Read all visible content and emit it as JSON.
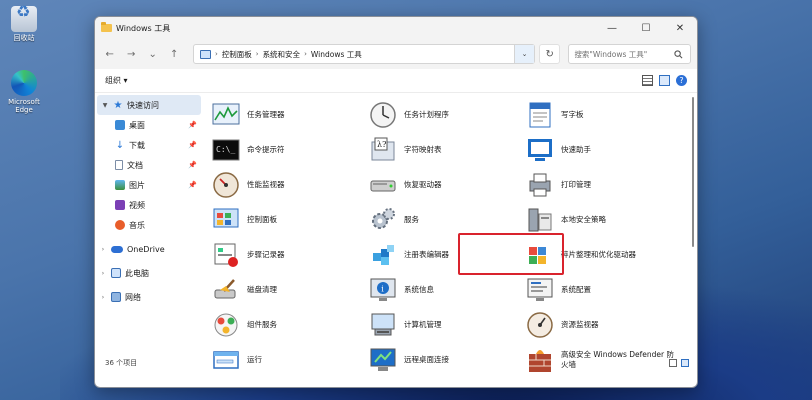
{
  "desktop": {
    "icons": [
      {
        "label": "回收站",
        "icon": "recycle-bin-icon"
      },
      {
        "label": "Microsoft Edge",
        "icon": "edge-icon"
      }
    ]
  },
  "window": {
    "title": "Windows 工具",
    "controls": {
      "minimize": "—",
      "maximize": "☐",
      "close": "✕"
    }
  },
  "nav": {
    "back": "←",
    "forward": "→",
    "dropdown": "⌄",
    "up": "↑",
    "breadcrumb": [
      "控制面板",
      "系统和安全",
      "Windows 工具"
    ],
    "separator": "›",
    "refresh": "↻",
    "search_placeholder": "搜索\"Windows 工具\""
  },
  "toolbar": {
    "organize": "组织 ▾"
  },
  "sidebar": {
    "quick_access": "快速访问",
    "pinned": [
      {
        "label": "桌面",
        "icon": "desktop-icon"
      },
      {
        "label": "下载",
        "icon": "download-icon"
      },
      {
        "label": "文档",
        "icon": "document-icon"
      },
      {
        "label": "图片",
        "icon": "pictures-icon"
      }
    ],
    "unpinned": [
      {
        "label": "视频",
        "icon": "video-icon"
      },
      {
        "label": "音乐",
        "icon": "music-icon"
      }
    ],
    "roots": [
      {
        "label": "OneDrive",
        "icon": "onedrive-icon"
      },
      {
        "label": "此电脑",
        "icon": "this-pc-icon"
      },
      {
        "label": "网络",
        "icon": "network-icon"
      }
    ]
  },
  "items": [
    {
      "label": "任务管理器",
      "icon": "task-manager-icon"
    },
    {
      "label": "任务计划程序",
      "icon": "task-scheduler-icon"
    },
    {
      "label": "写字板",
      "icon": "wordpad-icon"
    },
    {
      "label": "命令提示符",
      "icon": "command-prompt-icon"
    },
    {
      "label": "字符映射表",
      "icon": "character-map-icon"
    },
    {
      "label": "快速助手",
      "icon": "quick-assist-icon"
    },
    {
      "label": "性能监视器",
      "icon": "performance-monitor-icon"
    },
    {
      "label": "恢复驱动器",
      "icon": "recovery-drive-icon"
    },
    {
      "label": "打印管理",
      "icon": "print-management-icon"
    },
    {
      "label": "控制面板",
      "icon": "control-panel-icon"
    },
    {
      "label": "服务",
      "icon": "services-icon"
    },
    {
      "label": "本地安全策略",
      "icon": "local-security-policy-icon"
    },
    {
      "label": "步骤记录器",
      "icon": "steps-recorder-icon"
    },
    {
      "label": "注册表编辑器",
      "icon": "registry-editor-icon"
    },
    {
      "label": "碎片整理和优化驱动器",
      "icon": "defragment-icon"
    },
    {
      "label": "磁盘清理",
      "icon": "disk-cleanup-icon"
    },
    {
      "label": "系统信息",
      "icon": "system-information-icon"
    },
    {
      "label": "系统配置",
      "icon": "system-configuration-icon"
    },
    {
      "label": "组件服务",
      "icon": "component-services-icon"
    },
    {
      "label": "计算机管理",
      "icon": "computer-management-icon"
    },
    {
      "label": "资源监视器",
      "icon": "resource-monitor-icon"
    },
    {
      "label": "运行",
      "icon": "run-icon"
    },
    {
      "label": "远程桌面连接",
      "icon": "remote-desktop-icon"
    },
    {
      "label": "高级安全 Windows Defender 防火墙",
      "icon": "firewall-icon"
    }
  ],
  "status": {
    "count": "36 个项目"
  },
  "colors": {
    "highlight": "#d9232d",
    "accent": "#2a78d6"
  }
}
